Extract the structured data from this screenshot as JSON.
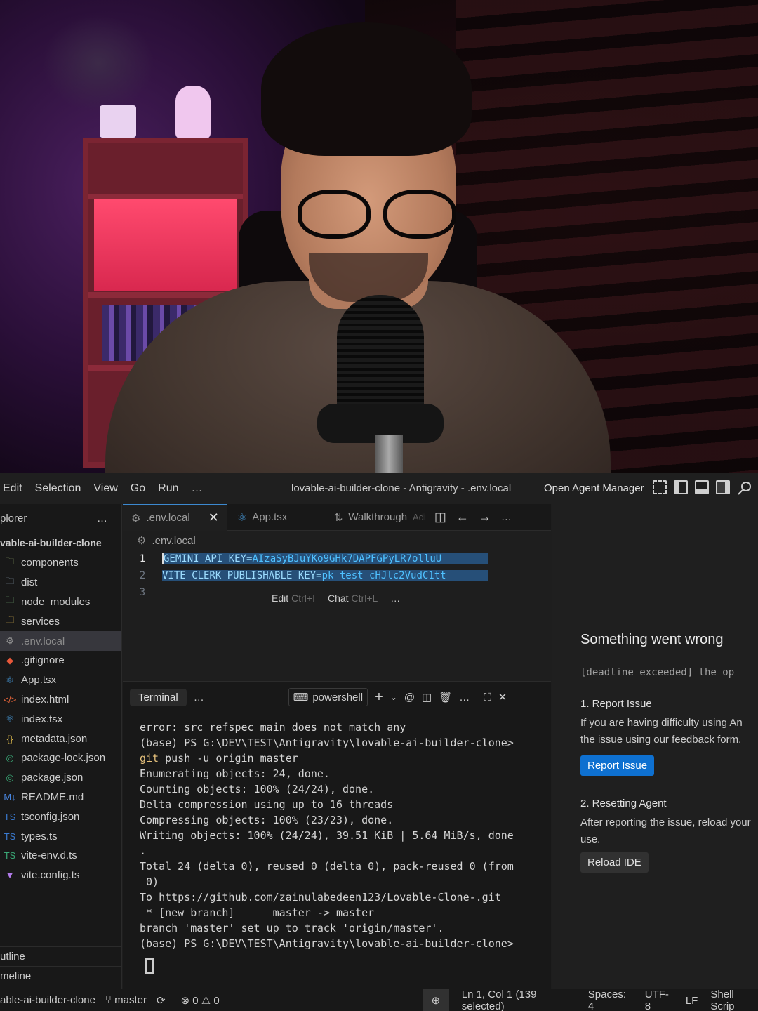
{
  "menu": [
    "Edit",
    "Selection",
    "View",
    "Go",
    "Run",
    "…"
  ],
  "window_title": "lovable-ai-builder-clone - Antigravity - .env.local",
  "open_agent_manager": "Open Agent Manager",
  "explorer": {
    "title": "plorer",
    "more": "…",
    "project": "vable-ai-builder-clone",
    "items": [
      {
        "label": "components",
        "icon": "folder-icon",
        "icon_color": "#7a8c5b"
      },
      {
        "label": "dist",
        "icon": "folder-icon",
        "icon_color": "#7a8c9b"
      },
      {
        "label": "node_modules",
        "icon": "folder-icon",
        "icon_color": "#6a9a6a"
      },
      {
        "label": "services",
        "icon": "folder-icon",
        "icon_color": "#caa84a"
      },
      {
        "label": ".env.local",
        "icon": "gear-icon",
        "icon_color": "#8f8f8f",
        "selected": true
      },
      {
        "label": ".gitignore",
        "icon": "git-icon",
        "icon_color": "#e8583a"
      },
      {
        "label": "App.tsx",
        "icon": "react-icon",
        "icon_color": "#4aa3e8"
      },
      {
        "label": "index.html",
        "icon": "html-icon",
        "icon_color": "#e8653a"
      },
      {
        "label": "index.tsx",
        "icon": "react-icon",
        "icon_color": "#4aa3e8"
      },
      {
        "label": "metadata.json",
        "icon": "json-icon",
        "icon_color": "#d6b44a"
      },
      {
        "label": "package-lock.json",
        "icon": "npm-icon",
        "icon_color": "#3aa876"
      },
      {
        "label": "package.json",
        "icon": "npm-icon",
        "icon_color": "#3aa876"
      },
      {
        "label": "README.md",
        "icon": "markdown-icon",
        "icon_color": "#4a8ae8"
      },
      {
        "label": "tsconfig.json",
        "icon": "ts-icon",
        "icon_color": "#3a7ad0"
      },
      {
        "label": "types.ts",
        "icon": "ts-icon",
        "icon_color": "#3a7ad0"
      },
      {
        "label": "vite-env.d.ts",
        "icon": "ts-icon",
        "icon_color": "#3aa876"
      },
      {
        "label": "vite.config.ts",
        "icon": "vite-icon",
        "icon_color": "#b07ae8"
      }
    ],
    "outline": "utline",
    "timeline": "meline"
  },
  "tabs": [
    {
      "label": ".env.local",
      "icon": "gear-icon",
      "active": true
    },
    {
      "label": "App.tsx",
      "icon": "react-icon"
    },
    {
      "label": "Walkthrough",
      "icon": "compare-icon",
      "suffix": "Adi"
    }
  ],
  "breadcrumb": ".env.local",
  "code_lines": [
    {
      "n": "1",
      "key": "GEMINI_API_KEY",
      "value": "AIzaSyBJuYKo9GHk7DAPFGPyLR7olluU_"
    },
    {
      "n": "2",
      "key": "VITE_CLERK_PUBLISHABLE_KEY",
      "value": "pk_test_cHJlc2VudC1tt"
    },
    {
      "n": "3",
      "key": "",
      "value": ""
    }
  ],
  "inline_hint": {
    "edit": "Edit",
    "edit_key": "Ctrl+I",
    "chat": "Chat",
    "chat_key": "Ctrl+L",
    "more": "…"
  },
  "panel": {
    "tab": "Terminal",
    "more": "…",
    "shell": "powershell"
  },
  "terminal_lines": [
    "error: src refspec main does not match any",
    "(base) PS G:\\DEV\\TEST\\Antigravity\\lovable-ai-builder-clone>",
    "Enumerating objects: 24, done.",
    "Counting objects: 100% (24/24), done.",
    "Delta compression using up to 16 threads",
    "Compressing objects: 100% (23/23), done.",
    "Writing objects: 100% (24/24), 39.51 KiB | 5.64 MiB/s, done",
    ".",
    "Total 24 (delta 0), reused 0 (delta 0), pack-reused 0 (from",
    " 0)",
    "To https://github.com/zainulabedeen123/Lovable-Clone-.git",
    " * [new branch]      master -> master",
    "branch 'master' set up to track 'origin/master'.",
    "(base) PS G:\\DEV\\TEST\\Antigravity\\lovable-ai-builder-clone>"
  ],
  "git_command": {
    "cmd": "git",
    "args": " push -u origin master"
  },
  "agent": {
    "title": "Something went wrong",
    "error": "[deadline_exceeded] the op",
    "report_title": "1. Report Issue",
    "report_desc_1": "If you are having difficulty using An",
    "report_desc_2": "the issue using our feedback form.",
    "report_button": "Report Issue",
    "reset_title": "2. Resetting Agent",
    "reset_desc_1": "After reporting the issue, reload your",
    "reset_desc_2": "use.",
    "reload_button": "Reload IDE"
  },
  "status": {
    "project": "able-ai-builder-clone",
    "branch": "master",
    "errors": "0",
    "warnings": "0",
    "position": "Ln 1, Col 1 (139 selected)",
    "spaces": "Spaces: 4",
    "encoding": "UTF-8",
    "eol": "LF",
    "language": "Shell Scrip"
  }
}
